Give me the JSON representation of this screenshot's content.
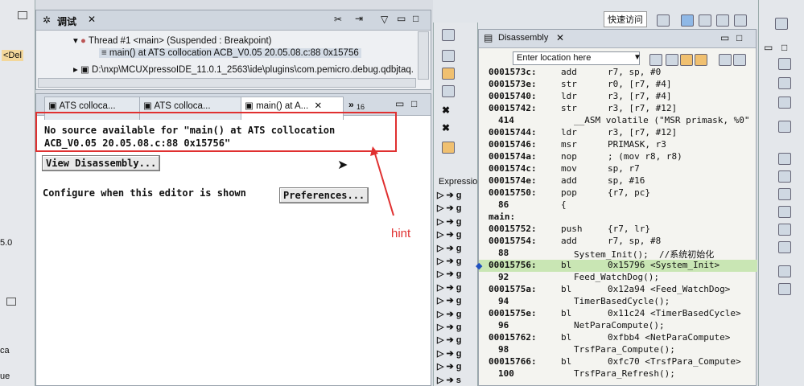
{
  "left_strip": {
    "tab_label": "<Del",
    "frag1": "5.0",
    "frag2": "ca",
    "frag3": "ue"
  },
  "debug_view": {
    "title": "调试",
    "thread": "Thread #1 <main> (Suspended : Breakpoint)",
    "frame": "main() at ATS collocation ACB_V0.05 20.05.08.c:88 0x15756",
    "path": "D:\\nxp\\MCUXpressoIDE_11.0.1_2563\\ide\\plugins\\com.pemicro.debug.qdbjtaq."
  },
  "editor": {
    "tabs": [
      "ATS colloca...",
      "ATS colloca...",
      "main() at A..."
    ],
    "overflow": "»",
    "overflow_count": "16",
    "message_line1": "No source available for \"main() at ATS collocation",
    "message_line2": "ACB_V0.05  20.05.08.c:88 0x15756\"",
    "view_disassembly": "View Disassembly...",
    "configure_text": "Configure when this editor is shown",
    "preferences": "Preferences..."
  },
  "annotation": {
    "hint": "hint",
    "color": "#e03030"
  },
  "expressions": {
    "title": "Expressio",
    "rows": [
      "g",
      "g",
      "g",
      "g",
      "g",
      "g",
      "g",
      "g",
      "g",
      "g",
      "g",
      "g",
      "g",
      "g",
      "s"
    ]
  },
  "disassembly": {
    "title": "Disassembly",
    "location_placeholder": "Enter location here",
    "lines": [
      {
        "a": "0001573c:",
        "m": "add",
        "o": "r7, sp, #0"
      },
      {
        "a": "0001573e:",
        "m": "str",
        "o": "r0, [r7, #4]"
      },
      {
        "a": "00015740:",
        "m": "ldr",
        "o": "r3, [r7, #4]"
      },
      {
        "a": "00015742:",
        "m": "str",
        "o": "r3, [r7, #12]"
      },
      {
        "a": "414",
        "m": "",
        "o": "__ASM volatile (\"MSR primask, %0\""
      },
      {
        "a": "00015744:",
        "m": "ldr",
        "o": "r3, [r7, #12]"
      },
      {
        "a": "00015746:",
        "m": "msr",
        "o": "PRIMASK, r3"
      },
      {
        "a": "0001574a:",
        "m": "nop",
        "o": "; (mov r8, r8)"
      },
      {
        "a": "0001574c:",
        "m": "mov",
        "o": "sp, r7"
      },
      {
        "a": "0001574e:",
        "m": "add",
        "o": "sp, #16"
      },
      {
        "a": "00015750:",
        "m": "pop",
        "o": "{r7, pc}"
      },
      {
        "a": "86",
        "m": "{",
        "o": ""
      },
      {
        "a": "main:",
        "m": "",
        "o": ""
      },
      {
        "a": "00015752:",
        "m": "push",
        "o": "{r7, lr}"
      },
      {
        "a": "00015754:",
        "m": "add",
        "o": "r7, sp, #8"
      },
      {
        "a": "88",
        "m": "",
        "o": "System_Init();  //系统初始化"
      },
      {
        "a": "00015756:",
        "m": "bl",
        "o": "0x15796 <System_Init>"
      },
      {
        "a": "92",
        "m": "",
        "o": "Feed_WatchDog();"
      },
      {
        "a": "0001575a:",
        "m": "bl",
        "o": "0x12a94 <Feed_WatchDog>"
      },
      {
        "a": "94",
        "m": "",
        "o": "TimerBasedCycle();"
      },
      {
        "a": "0001575e:",
        "m": "bl",
        "o": "0x11c24 <TimerBasedCycle>"
      },
      {
        "a": "96",
        "m": "",
        "o": "NetParaCompute();"
      },
      {
        "a": "00015762:",
        "m": "bl",
        "o": "0xfbb4 <NetParaCompute>"
      },
      {
        "a": "98",
        "m": "",
        "o": "TrsfPara_Compute();"
      },
      {
        "a": "00015766:",
        "m": "bl",
        "o": "0xfc70 <TrsfPara_Compute>"
      },
      {
        "a": "100",
        "m": "",
        "o": "TrsfPara_Refresh();"
      }
    ]
  },
  "toolbar": {
    "quick_access": "快速访问"
  }
}
